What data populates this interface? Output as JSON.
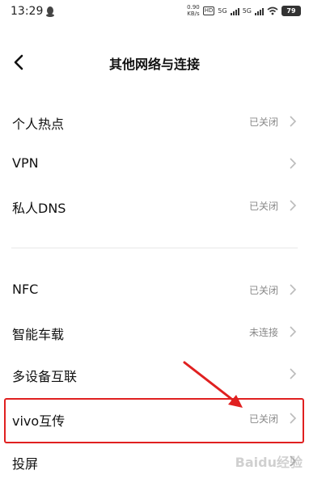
{
  "status": {
    "time": "13:29",
    "speed_value": "0.90",
    "speed_unit": "KB/s",
    "hd": "HD",
    "sim1_net": "5G",
    "sim2_net": "5G",
    "battery": "79"
  },
  "nav": {
    "title": "其他网络与连接"
  },
  "items": [
    {
      "label": "个人热点",
      "value": "已关闭"
    },
    {
      "label": "VPN",
      "value": ""
    },
    {
      "label": "私人DNS",
      "value": "已关闭"
    },
    {
      "label": "NFC",
      "value": "已关闭"
    },
    {
      "label": "智能车载",
      "value": "未连接"
    },
    {
      "label": "多设备互联",
      "value": ""
    },
    {
      "label": "vivo互传",
      "value": "已关闭"
    },
    {
      "label": "投屏",
      "value": ""
    }
  ],
  "annotation": {
    "highlight_color": "#e02020"
  },
  "watermark": "Baidu经验"
}
